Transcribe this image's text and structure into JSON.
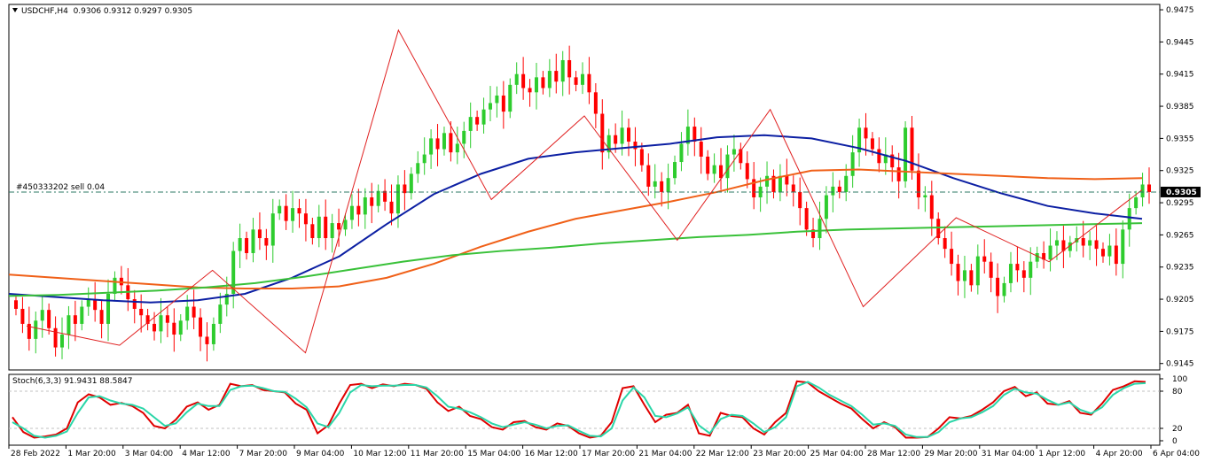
{
  "symbol_header": {
    "symbol": "USDCHF,H4",
    "quote": "0.9306 0.9312 0.9297 0.9305"
  },
  "order_line": {
    "label": "#450333202 sell 0.04",
    "price": 0.9305
  },
  "current_price_label": "0.9305",
  "stoch_header": {
    "name": "Stoch(6,3,3)",
    "values": "91.9431 88.5847"
  },
  "colors": {
    "bull_candle": "#2ecc2e",
    "bear_candle": "#ff0000",
    "ma_blue": "#0c1fa3",
    "ma_orange": "#f06018",
    "ma_green": "#39c139",
    "zigzag": "#e02020",
    "stoch_main": "#e00000",
    "stoch_signal": "#2ad6a8",
    "order_line": "#2d7a66",
    "grid": "#c0c0c0"
  },
  "chart_data": [
    {
      "type": "candlestick",
      "title": "USDCHF,H4",
      "y_ticks": [
        "0.9475",
        "0.9445",
        "0.9415",
        "0.9385",
        "0.9355",
        "0.9325",
        "0.9295",
        "0.9265",
        "0.9235",
        "0.9205",
        "0.9175",
        "0.9145"
      ],
      "ylim": [
        0.9139,
        0.948
      ],
      "x_tick_labels": [
        "28 Feb 2022",
        "1 Mar 20:00",
        "3 Mar 04:00",
        "4 Mar 12:00",
        "7 Mar 20:00",
        "9 Mar 04:00",
        "10 Mar 12:00",
        "11 Mar 20:00",
        "15 Mar 04:00",
        "16 Mar 12:00",
        "17 Mar 20:00",
        "21 Mar 04:00",
        "22 Mar 12:00",
        "23 Mar 20:00",
        "25 Mar 04:00",
        "28 Mar 12:00",
        "29 Mar 20:00",
        "31 Mar 04:00",
        "1 Apr 12:00",
        "4 Apr 20:00",
        "6 Apr 04:00"
      ],
      "closes": [
        0.9196,
        0.9182,
        0.9168,
        0.9185,
        0.9195,
        0.9178,
        0.916,
        0.9172,
        0.919,
        0.9182,
        0.9198,
        0.9205,
        0.9195,
        0.9182,
        0.921,
        0.9225,
        0.9218,
        0.9205,
        0.9196,
        0.919,
        0.9182,
        0.9175,
        0.919,
        0.9183,
        0.9172,
        0.9185,
        0.9198,
        0.9188,
        0.917,
        0.9163,
        0.9182,
        0.92,
        0.921,
        0.925,
        0.9262,
        0.9248,
        0.927,
        0.9262,
        0.9255,
        0.9285,
        0.9292,
        0.9278,
        0.929,
        0.9285,
        0.9275,
        0.9262,
        0.9282,
        0.9262,
        0.9276,
        0.927,
        0.9279,
        0.9292,
        0.9284,
        0.93,
        0.9292,
        0.9306,
        0.9296,
        0.9285,
        0.9312,
        0.9304,
        0.9322,
        0.9332,
        0.934,
        0.9355,
        0.9345,
        0.936,
        0.9342,
        0.935,
        0.9362,
        0.9375,
        0.9368,
        0.9382,
        0.9388,
        0.9395,
        0.938,
        0.9405,
        0.9415,
        0.9402,
        0.9398,
        0.9412,
        0.9402,
        0.9418,
        0.9408,
        0.9428,
        0.9412,
        0.9405,
        0.9415,
        0.9398,
        0.9378,
        0.9342,
        0.9358,
        0.935,
        0.9365,
        0.9352,
        0.9345,
        0.933,
        0.931,
        0.9315,
        0.9305,
        0.9318,
        0.9333,
        0.935,
        0.9366,
        0.9352,
        0.9338,
        0.9322,
        0.933,
        0.9318,
        0.934,
        0.9345,
        0.9332,
        0.9317,
        0.93,
        0.931,
        0.932,
        0.9305,
        0.932,
        0.9312,
        0.9305,
        0.929,
        0.927,
        0.9262,
        0.928,
        0.9302,
        0.931,
        0.9305,
        0.932,
        0.9342,
        0.9365,
        0.9355,
        0.9345,
        0.9332,
        0.934,
        0.9328,
        0.9315,
        0.9365,
        0.9325,
        0.93,
        0.9302,
        0.928,
        0.9262,
        0.9252,
        0.9238,
        0.9222,
        0.9232,
        0.9218,
        0.9245,
        0.924,
        0.9225,
        0.9208,
        0.922,
        0.9238,
        0.9232,
        0.9225,
        0.924,
        0.9248,
        0.9242,
        0.9255,
        0.926,
        0.925,
        0.9258,
        0.9262,
        0.9255,
        0.926,
        0.9252,
        0.9245,
        0.9255,
        0.9238,
        0.927,
        0.929,
        0.93,
        0.9312,
        0.9305
      ],
      "series": [
        {
          "name": "",
          "color": "#0c1fa3",
          "values": [
            0.921,
            0.9207,
            0.9204,
            0.9202,
            0.9204,
            0.921,
            0.9225,
            0.9245,
            0.9275,
            0.9303,
            0.9322,
            0.9336,
            0.9342,
            0.9346,
            0.935,
            0.9356,
            0.9358,
            0.9355,
            0.9346,
            0.9334,
            0.9318,
            0.9304,
            0.9292,
            0.9285,
            0.928
          ]
        },
        {
          "name": "",
          "color": "#f06018",
          "values": [
            0.9228,
            0.9225,
            0.9222,
            0.9219,
            0.9216,
            0.9215,
            0.9215,
            0.9217,
            0.9225,
            0.9238,
            0.9254,
            0.9268,
            0.928,
            0.9288,
            0.9296,
            0.9305,
            0.9316,
            0.9325,
            0.9326,
            0.9324,
            0.9322,
            0.932,
            0.9318,
            0.9317,
            0.9318
          ]
        },
        {
          "name": "",
          "color": "#39c139",
          "values": [
            0.9208,
            0.9209,
            0.9211,
            0.9213,
            0.9216,
            0.922,
            0.9226,
            0.9233,
            0.924,
            0.9246,
            0.925,
            0.9253,
            0.9257,
            0.926,
            0.9263,
            0.9265,
            0.9268,
            0.927,
            0.9271,
            0.9272,
            0.9273,
            0.9274,
            0.9275,
            0.9276
          ]
        }
      ],
      "zigzag": [
        0.918,
        0.9162,
        0.9232,
        0.9155,
        0.9456,
        0.9298,
        0.9376,
        0.926,
        0.9382,
        0.9198,
        0.9281,
        0.924,
        0.9307
      ]
    },
    {
      "type": "line",
      "title": "Stoch(6,3,3)",
      "y_ticks": [
        "100",
        "80",
        "20",
        "0"
      ],
      "ylim": [
        0,
        100
      ],
      "series": [
        {
          "name": "",
          "color": "#e00000",
          "values": [
            38,
            14,
            5,
            7,
            10,
            20,
            62,
            75,
            70,
            58,
            61,
            56,
            45,
            24,
            20,
            34,
            55,
            62,
            50,
            58,
            92,
            88,
            90,
            82,
            80,
            78,
            60,
            50,
            12,
            25,
            60,
            90,
            92,
            85,
            91,
            88,
            92,
            90,
            84,
            62,
            48,
            55,
            40,
            35,
            22,
            18,
            30,
            32,
            22,
            18,
            28,
            24,
            12,
            5,
            8,
            30,
            85,
            88,
            58,
            30,
            42,
            45,
            58,
            12,
            8,
            45,
            40,
            38,
            20,
            10,
            30,
            45,
            96,
            94,
            80,
            70,
            60,
            52,
            35,
            20,
            30,
            22,
            5,
            5,
            6,
            20,
            38,
            36,
            40,
            50,
            62,
            80,
            87,
            72,
            78,
            60,
            58,
            64,
            45,
            42,
            60,
            82,
            88,
            96,
            95
          ]
        },
        {
          "name": "",
          "color": "#2ad6a8",
          "values": [
            30,
            20,
            8,
            5,
            8,
            15,
            45,
            70,
            72,
            65,
            60,
            58,
            52,
            38,
            24,
            28,
            46,
            60,
            56,
            56,
            82,
            88,
            89,
            85,
            80,
            79,
            68,
            54,
            28,
            22,
            45,
            78,
            90,
            88,
            89,
            89,
            90,
            90,
            86,
            72,
            55,
            52,
            46,
            38,
            28,
            22,
            26,
            30,
            26,
            20,
            24,
            25,
            16,
            8,
            7,
            20,
            65,
            86,
            70,
            40,
            38,
            44,
            54,
            25,
            12,
            35,
            42,
            40,
            28,
            14,
            22,
            38,
            88,
            95,
            86,
            74,
            65,
            56,
            42,
            26,
            28,
            24,
            10,
            6,
            6,
            14,
            30,
            36,
            38,
            46,
            56,
            74,
            84,
            78,
            76,
            66,
            58,
            62,
            50,
            44,
            54,
            74,
            85,
            92,
            93
          ]
        }
      ]
    }
  ]
}
